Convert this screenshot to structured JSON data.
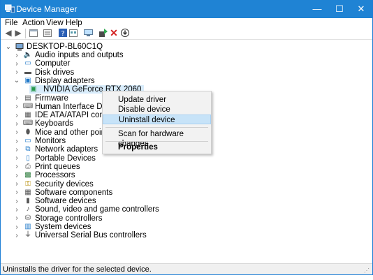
{
  "window": {
    "title": "Device Manager",
    "controls": {
      "minimize": "—",
      "maximize": "☐",
      "close": "✕"
    }
  },
  "menu": [
    "File",
    "Action",
    "View",
    "Help"
  ],
  "toolbar": [
    "back-icon",
    "forward-icon",
    "properties-window-icon",
    "view-details-icon",
    "help-icon",
    "device-panel-icon",
    "monitor-scan-icon",
    "update-driver-icon",
    "uninstall-x-icon",
    "download-circle-icon"
  ],
  "tree": {
    "root": "DESKTOP-BL60C1Q",
    "categories": [
      {
        "label": "Audio inputs and outputs",
        "icon": "speaker-icon",
        "expanded": false
      },
      {
        "label": "Computer",
        "icon": "computer-icon",
        "expanded": false
      },
      {
        "label": "Disk drives",
        "icon": "disk-icon",
        "expanded": false
      },
      {
        "label": "Display adapters",
        "icon": "display-adapter-icon",
        "expanded": true
      },
      {
        "label": "NVIDIA GeForce RTX 2060",
        "icon": "gpu-icon",
        "child": true
      },
      {
        "label": "Firmware",
        "icon": "firmware-icon",
        "expanded": false
      },
      {
        "label": "Human Interface Devices",
        "icon": "hid-icon",
        "expanded": false
      },
      {
        "label": "IDE ATA/ATAPI controllers",
        "icon": "ide-icon",
        "expanded": false
      },
      {
        "label": "Keyboards",
        "icon": "keyboard-icon",
        "expanded": false
      },
      {
        "label": "Mice and other pointing dev",
        "icon": "mouse-icon",
        "expanded": false
      },
      {
        "label": "Monitors",
        "icon": "monitor-icon",
        "expanded": false
      },
      {
        "label": "Network adapters",
        "icon": "network-icon",
        "expanded": false
      },
      {
        "label": "Portable Devices",
        "icon": "portable-icon",
        "expanded": false
      },
      {
        "label": "Print queues",
        "icon": "printer-icon",
        "expanded": false
      },
      {
        "label": "Processors",
        "icon": "processor-icon",
        "expanded": false
      },
      {
        "label": "Security devices",
        "icon": "security-icon",
        "expanded": false
      },
      {
        "label": "Software components",
        "icon": "software-component-icon",
        "expanded": false
      },
      {
        "label": "Software devices",
        "icon": "software-device-icon",
        "expanded": false
      },
      {
        "label": "Sound, video and game controllers",
        "icon": "sound-icon",
        "expanded": false
      },
      {
        "label": "Storage controllers",
        "icon": "storage-icon",
        "expanded": false
      },
      {
        "label": "System devices",
        "icon": "system-icon",
        "expanded": false
      },
      {
        "label": "Universal Serial Bus controllers",
        "icon": "usb-icon",
        "expanded": false
      }
    ]
  },
  "context_menu": {
    "items": [
      "Update driver",
      "Disable device",
      "Uninstall device",
      "Scan for hardware changes",
      "Properties"
    ],
    "highlighted": "Uninstall device"
  },
  "status": "Uninstalls the driver for the selected device.",
  "colors": {
    "titlebar": "#1f83d4",
    "highlight": "#c7e3f8",
    "selection": "#d8ecfb"
  }
}
